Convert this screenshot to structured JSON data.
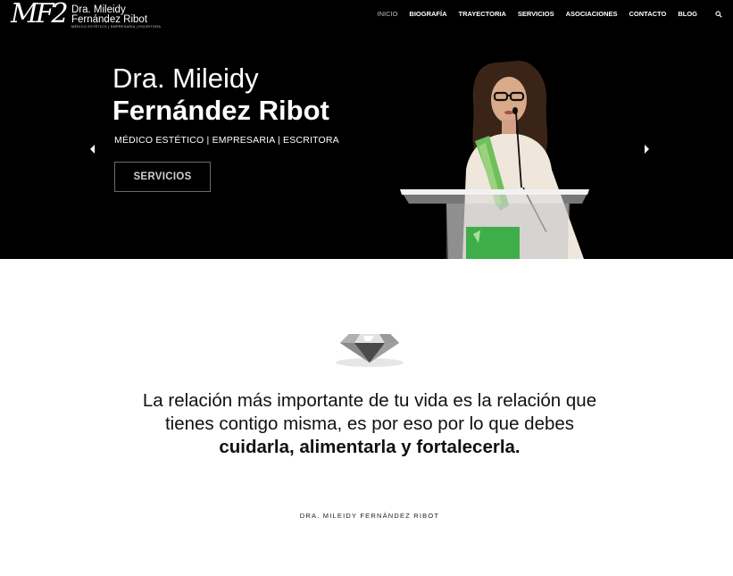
{
  "header": {
    "logo": {
      "monogram": "MF2",
      "name_line1": "Dra. Mileidy",
      "name_line2": "Fernández Ribot",
      "tagline": "MÉDICO ESTÉTICO | EMPRESARIA | ESCRITORA"
    },
    "nav": [
      {
        "label": "INICIO",
        "active": true
      },
      {
        "label": "BIOGRAFÍA"
      },
      {
        "label": "TRAYECTORIA"
      },
      {
        "label": "SERVICIOS"
      },
      {
        "label": "ASOCIACIONES"
      },
      {
        "label": "CONTACTO"
      },
      {
        "label": "BLOG"
      }
    ],
    "search_icon": "search-icon"
  },
  "hero": {
    "title_line1": "Dra. Mileidy",
    "title_line2": "Fernández Ribot",
    "subtitle": "MÉDICO ESTÉTICO | EMPRESARIA | ESCRITORA",
    "button_label": "SERVICIOS",
    "prev_icon": "chevron-left-icon",
    "next_icon": "chevron-right-icon"
  },
  "quote": {
    "icon": "diamond-icon",
    "text_regular": "La relación más importante de tu vida es la relación que tienes contigo misma, es por eso por lo que debes ",
    "text_bold": "cuidarla, alimentarla y fortalecerla.",
    "signature": "DRA. MILEIDY FERNÁNDEZ RIBOT"
  },
  "colors": {
    "hero_bg": "#000000",
    "page_bg": "#ffffff",
    "accent_green": "#3fae49"
  }
}
